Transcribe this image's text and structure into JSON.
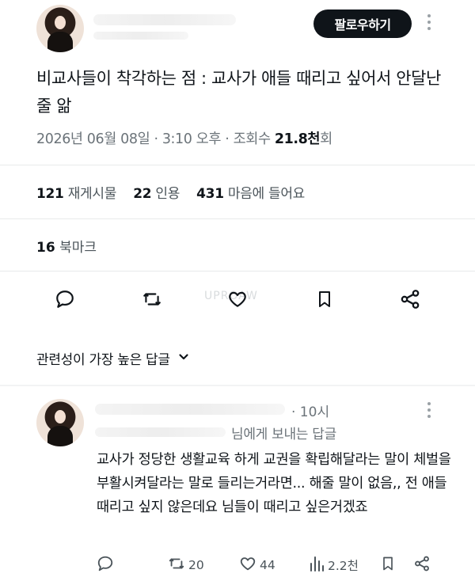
{
  "post": {
    "follow_label": "팔로우하기",
    "title": "비교사들이 착각하는 점 : 교사가 애들 때리고 싶어서 안달난 줄 앎",
    "date": "2026년 06월 08일",
    "sep1": " · ",
    "time": "3:10 오후",
    "sep2": " · ",
    "views_label": "조회수",
    "views_value": "21.8천",
    "views_suffix": "회"
  },
  "stats": {
    "retweets_num": "121",
    "retweets_label": "재게시물",
    "quotes_num": "22",
    "quotes_label": "인용",
    "likes_num": "431",
    "likes_label": "마음에 들어요",
    "bookmarks_num": "16",
    "bookmarks_label": "북마크"
  },
  "actions": {
    "icons": [
      "reply-icon",
      "retweet-icon",
      "like-icon",
      "bookmark-icon",
      "share-icon"
    ]
  },
  "watermark": "UPROAW",
  "sort": {
    "label": "관련성이 가장 높은 답글",
    "icon": "chevron-down-icon"
  },
  "reply": {
    "time": "· 10시",
    "reply_to": "님에게 보내는 답글",
    "text": "교사가 정당한 생활교육 하게 교권을 확립해달라는 말이 체벌을 부활시켜달라는 말로 들리는거라면... 해줄 말이 없음,, 전 애들 때리고 싶지 않은데요 님들이 때리고 싶은거겠죠",
    "retweets": "20",
    "likes": "44",
    "views": "2.2천"
  },
  "colors": {
    "text": "#0f1419",
    "muted": "#6b7379",
    "button_bg": "#0f1419",
    "divider": "#e8eaeb"
  }
}
